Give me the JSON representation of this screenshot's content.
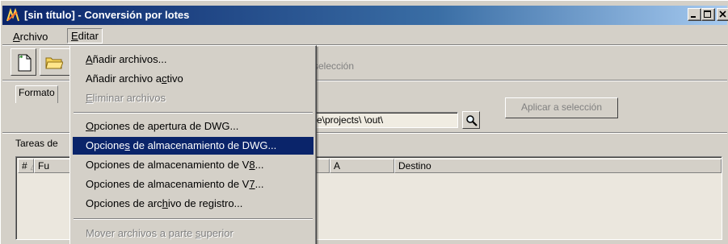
{
  "window": {
    "title": "[sin título] - Conversión por lotes"
  },
  "menubar": {
    "archivo": {
      "pre": "",
      "accel": "A",
      "post": "rchivo"
    },
    "editar": {
      "pre": "",
      "accel": "E",
      "post": "ditar"
    }
  },
  "toolbar": {
    "apply_selection_disabled": "selección"
  },
  "form": {
    "formato_tab": "Formato",
    "path_value": "e\\projects\\ \\out\\",
    "apply_button": "Aplicar a selección"
  },
  "tasks": {
    "label": "Tareas de",
    "columns": [
      "#",
      "Fu",
      "A",
      "Destino"
    ]
  },
  "edit_menu": {
    "items": [
      {
        "pre": "",
        "accel": "A",
        "post": "ñadir archivos...",
        "disabled": false
      },
      {
        "pre": "Añadir archivo a",
        "accel": "c",
        "post": "tivo",
        "disabled": false
      },
      {
        "pre": "",
        "accel": "E",
        "post": "liminar archivos",
        "disabled": true
      },
      {
        "pre": "",
        "accel": "O",
        "post": "pciones de apertura de DWG...",
        "disabled": false
      },
      {
        "pre": "Opcione",
        "accel": "s",
        "post": " de almacenamiento de DWG...",
        "disabled": false,
        "active": true
      },
      {
        "pre": "Opciones de almacenamiento de V",
        "accel": "8",
        "post": "...",
        "disabled": false
      },
      {
        "pre": "Opciones de almacenamiento de V",
        "accel": "7",
        "post": "...",
        "disabled": false
      },
      {
        "pre": "Opciones de arc",
        "accel": "h",
        "post": "ivo de registro...",
        "disabled": false
      },
      {
        "pre": "Mover archivos a parte ",
        "accel": "s",
        "post": "uperior",
        "disabled": true
      }
    ]
  },
  "colors": {
    "title_start": "#0a246a",
    "title_end": "#a6caf0",
    "highlight": "#0a246a",
    "face": "#d4d0c8"
  }
}
